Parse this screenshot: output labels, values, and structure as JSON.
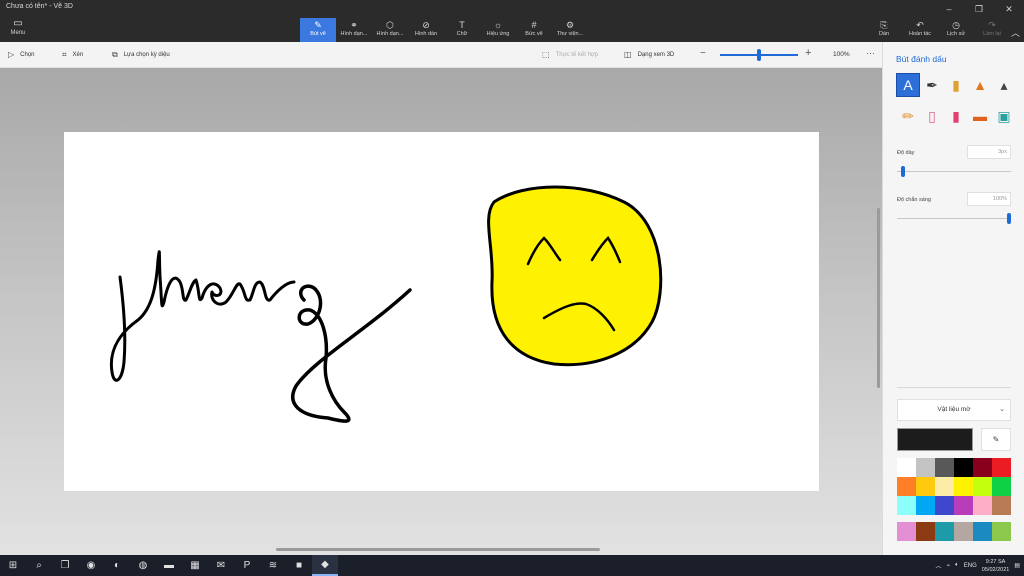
{
  "window": {
    "title": "Chưa có tên* - Vẽ 3D"
  },
  "ribbon": {
    "menu_label": "Menu",
    "tools": [
      {
        "id": "brushes",
        "label": "Bút vẽ",
        "icon": "✎",
        "active": true
      },
      {
        "id": "2dshapes",
        "label": "Hình dạn...",
        "icon": "⚭",
        "active": false
      },
      {
        "id": "3dshapes",
        "label": "Hình dạn...",
        "icon": "⬡",
        "active": false
      },
      {
        "id": "stickers",
        "label": "Hình dán",
        "icon": "⊘",
        "active": false
      },
      {
        "id": "text",
        "label": "Chữ",
        "icon": "T",
        "active": false
      },
      {
        "id": "effects",
        "label": "Hiệu ứng",
        "icon": "☼",
        "active": false
      },
      {
        "id": "canvas",
        "label": "Bức vẽ",
        "icon": "#",
        "active": false
      },
      {
        "id": "library",
        "label": "Thư viện...",
        "icon": "⚙",
        "active": false
      }
    ],
    "right_tools": [
      {
        "id": "paste",
        "label": "Dán",
        "icon": "⎘",
        "disabled": false
      },
      {
        "id": "undo",
        "label": "Hoàn tác",
        "icon": "↶",
        "disabled": false
      },
      {
        "id": "history",
        "label": "Lịch sử",
        "icon": "◷",
        "disabled": false
      },
      {
        "id": "redo",
        "label": "Làm lại",
        "icon": "↷",
        "disabled": true
      }
    ]
  },
  "subbar": {
    "select_label": "Chọn",
    "crop_label": "Xén",
    "magic_select_label": "Lựa chọn kỳ diệu",
    "mixed_reality_label": "Thực tế kết hợp",
    "view3d_label": "Dạng xem 3D",
    "zoom_value": "100%",
    "zoom_fraction": 0.5
  },
  "panel": {
    "title": "Bút đánh dấu",
    "brushes": [
      {
        "name": "marker",
        "icon": "A",
        "color": "#ffffff",
        "active": true
      },
      {
        "name": "calligraphy-pen",
        "icon": "✒",
        "color": "#333333"
      },
      {
        "name": "oil-brush",
        "icon": "▮",
        "color": "#e0a030"
      },
      {
        "name": "watercolor",
        "icon": "▲",
        "color": "#e07820"
      },
      {
        "name": "pixel-pen",
        "icon": "▴",
        "color": "#444444"
      },
      {
        "name": "pencil",
        "icon": "✏",
        "color": "#e09030"
      },
      {
        "name": "eraser",
        "icon": "▯",
        "color": "#e06080"
      },
      {
        "name": "crayon",
        "icon": "▮",
        "color": "#e04070"
      },
      {
        "name": "spray-can",
        "icon": "▬",
        "color": "#e06020"
      },
      {
        "name": "fill",
        "icon": "▣",
        "color": "#2aa0a0"
      }
    ],
    "thickness_label": "Độ dày",
    "thickness_value": "3px",
    "thickness_fraction": 0.05,
    "opacity_label": "Độ chắn sáng",
    "opacity_value": "100%",
    "opacity_fraction": 1.0,
    "material_label": "Vật liệu mờ",
    "current_color": "#1c1c1c",
    "palette": [
      "#ffffff",
      "#c3c3c3",
      "#585858",
      "#000000",
      "#88001b",
      "#ec1c24",
      "#ff7f27",
      "#ffc90e",
      "#fdeca6",
      "#fff200",
      "#c4ff0e",
      "#0ed145",
      "#8cfffb",
      "#00a8f3",
      "#3f48cc",
      "#b83dba",
      "#ffaec8",
      "#b97a56"
    ],
    "palette_custom": [
      "#e48ed4",
      "#8b3a14",
      "#1e9ba8",
      "#b4a6a0",
      "#1a8ac0",
      "#8cc84b"
    ]
  },
  "taskbar": {
    "apps": [
      {
        "name": "start",
        "icon": "⊞"
      },
      {
        "name": "search",
        "icon": "⌕"
      },
      {
        "name": "task-view",
        "icon": "❐"
      },
      {
        "name": "chrome",
        "icon": "◉"
      },
      {
        "name": "edge",
        "icon": "◐"
      },
      {
        "name": "app-green",
        "icon": "◍"
      },
      {
        "name": "file-explorer",
        "icon": "▬"
      },
      {
        "name": "store",
        "icon": "▦"
      },
      {
        "name": "mail",
        "icon": "✉"
      },
      {
        "name": "pinterest",
        "icon": "P"
      },
      {
        "name": "spotify",
        "icon": "≋"
      },
      {
        "name": "zoom",
        "icon": "■"
      },
      {
        "name": "paint3d",
        "icon": "◆",
        "open": true
      }
    ],
    "language": "ENG",
    "time": "9:27 SA",
    "date": "05/02/2021"
  }
}
